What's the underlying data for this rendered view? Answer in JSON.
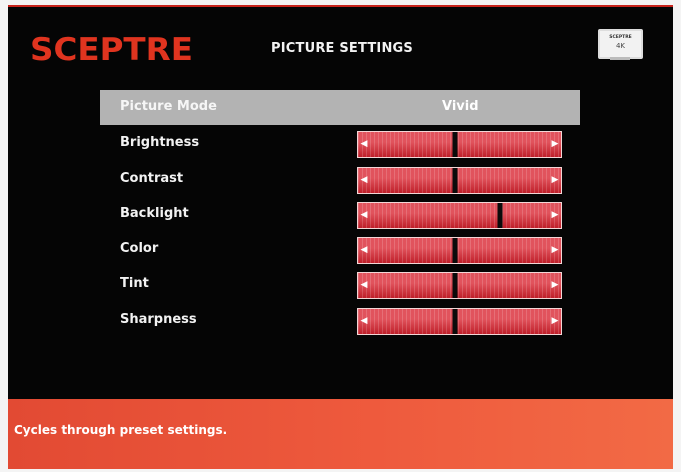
{
  "brand": {
    "logo": "SCEPTRE",
    "color": "#e0341f"
  },
  "header": {
    "title": "PICTURE SETTINGS"
  },
  "tv_icon": {
    "brand": "SCEPTRE",
    "resolution": "4K"
  },
  "picture_mode": {
    "label": "Picture Mode",
    "value": "Vivid"
  },
  "settings": [
    {
      "label": "Brightness",
      "level": 0.48
    },
    {
      "label": "Contrast",
      "level": 0.48
    },
    {
      "label": "Backlight",
      "level": 0.7
    },
    {
      "label": "Color",
      "level": 0.48
    },
    {
      "label": "Tint",
      "level": 0.48
    },
    {
      "label": "Sharpness",
      "level": 0.48
    }
  ],
  "icons": {
    "left_arrow": "chevron-left-icon",
    "right_arrow": "chevron-right-icon"
  },
  "help": {
    "text": "Cycles through preset settings."
  }
}
